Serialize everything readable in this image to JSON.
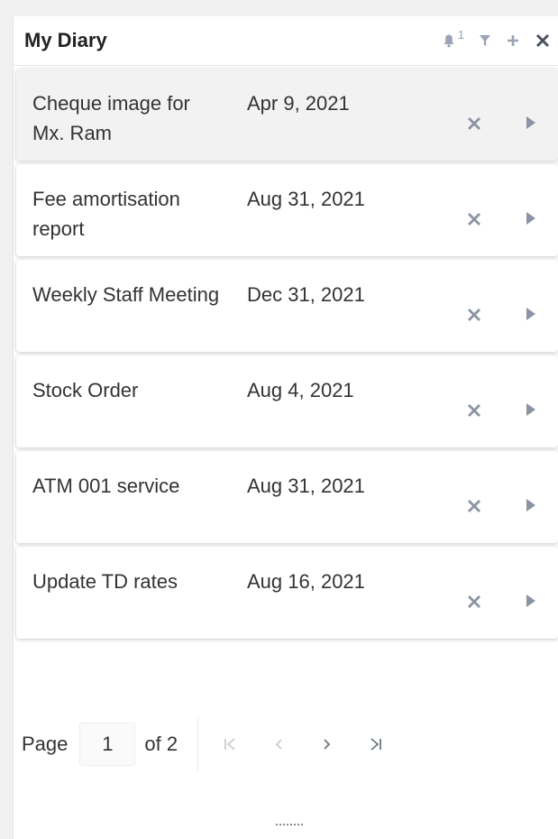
{
  "header": {
    "title": "My Diary",
    "notification_count": "1",
    "icons": [
      "bell-icon",
      "filter-icon",
      "plus-icon",
      "close-icon"
    ]
  },
  "items": [
    {
      "title": "Cheque image for Mx. Ram",
      "date": "Apr 9, 2021",
      "selected": true
    },
    {
      "title": "Fee amortisation report",
      "date": "Aug 31, 2021",
      "selected": false
    },
    {
      "title": "Weekly Staff Meeting",
      "date": "Dec 31, 2021",
      "selected": false
    },
    {
      "title": "Stock Order",
      "date": "Aug 4, 2021",
      "selected": false
    },
    {
      "title": "ATM 001 service",
      "date": "Aug 31, 2021",
      "selected": false
    },
    {
      "title": "Update TD rates",
      "date": "Aug 16, 2021",
      "selected": false
    }
  ],
  "pagination": {
    "page_label": "Page",
    "current_page": "1",
    "of_label": "of 2",
    "nav_icons": [
      "first-page-icon",
      "prev-page-icon",
      "next-page-icon",
      "last-page-icon"
    ]
  },
  "colors": {
    "header_icon": "#9aa4b4",
    "action_icon": "#8a94a3",
    "pager_disabled": "#c7ccd4",
    "pager_enabled": "#6f7784",
    "selected_card": "#f2f2f2"
  }
}
